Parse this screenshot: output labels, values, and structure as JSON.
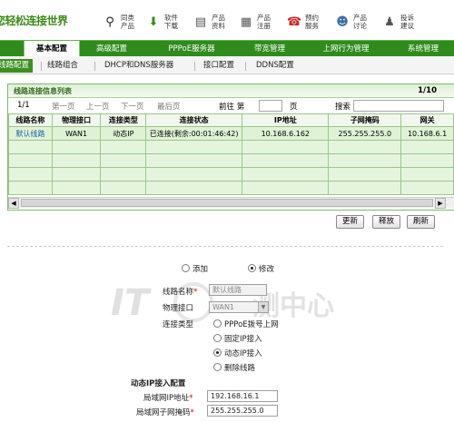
{
  "header": {
    "logo_text": "您轻松连接世界",
    "links": [
      {
        "icon": "search-icon",
        "glyph": "⚲",
        "color": "#222222",
        "line1": "同类",
        "line2": "产品"
      },
      {
        "icon": "download-icon",
        "glyph": "⬇",
        "color": "#3a8a16",
        "line1": "软件",
        "line2": "下载"
      },
      {
        "icon": "document-icon",
        "glyph": "▤",
        "color": "#555555",
        "line1": "产品",
        "line2": "资料"
      },
      {
        "icon": "register-icon",
        "glyph": "▦",
        "color": "#555555",
        "line1": "产品",
        "line2": "注册"
      },
      {
        "icon": "phone-icon",
        "glyph": "☎",
        "color": "#cc2222",
        "line1": "预约",
        "line2": "服务"
      },
      {
        "icon": "discussion-icon",
        "glyph": "☻",
        "color": "#3a6ea5",
        "line1": "产品",
        "line2": "讨论"
      },
      {
        "icon": "suggestion-icon",
        "glyph": "♟",
        "color": "#555555",
        "line1": "投诉",
        "line2": "建议"
      }
    ]
  },
  "main_nav": {
    "tabs": [
      "基本配置",
      "高级配置",
      "PPPoE服务器",
      "带宽管理",
      "上网行为管理",
      "系统管理"
    ],
    "active": 0
  },
  "sub_nav": {
    "tabs": [
      "线路配置",
      "线路组合",
      "DHCP和DNS服务器",
      "接口配置",
      "DDNS配置"
    ],
    "active": 0
  },
  "list": {
    "title": "线路连接信息列表",
    "page_indicator": "1/10",
    "pager": {
      "current": "1/1",
      "first": "第一页",
      "prev": "上一页",
      "next": "下一页",
      "last": "最后页",
      "goto_label": "前往 第",
      "page_unit": "页",
      "search_label": "搜索"
    },
    "columns": [
      "线路名称",
      "物理接口",
      "连接类型",
      "连接状态",
      "IP地址",
      "子网掩码",
      "网关"
    ],
    "rows": [
      [
        "默认线路",
        "WAN1",
        "动态IP",
        "已连接(剩余:00:01:46:42)",
        "10.168.6.162",
        "255.255.255.0",
        "10.168.6.1"
      ]
    ],
    "empty_rows": 4
  },
  "actions": {
    "refresh": "更新",
    "release": "释放",
    "reload": "刷新"
  },
  "form": {
    "mode_add": "添加",
    "mode_edit": "修改",
    "mode_selected": "edit",
    "line_name_label": "线路名称",
    "line_name_value": "默认线路",
    "interface_label": "物理接口",
    "interface_value": "WAN1",
    "conn_type_label": "连接类型",
    "conn_types": [
      "PPPoE拨号上网",
      "固定IP接入",
      "动态IP接入",
      "删除线路"
    ],
    "conn_type_selected": 2,
    "section_title": "动态IP接入配置",
    "lan_ip_label": "局域网IP地址",
    "lan_ip_value": "192.168.16.1",
    "lan_mask_label": "局域网子网掩码",
    "lan_mask_value": "255.255.255.0"
  },
  "watermark": {
    "brand": "IT",
    "text": "测中心"
  },
  "colors": {
    "nav_green": "#2e8b1c",
    "row_green": "#dff2d6",
    "required_red": "#d40000"
  }
}
